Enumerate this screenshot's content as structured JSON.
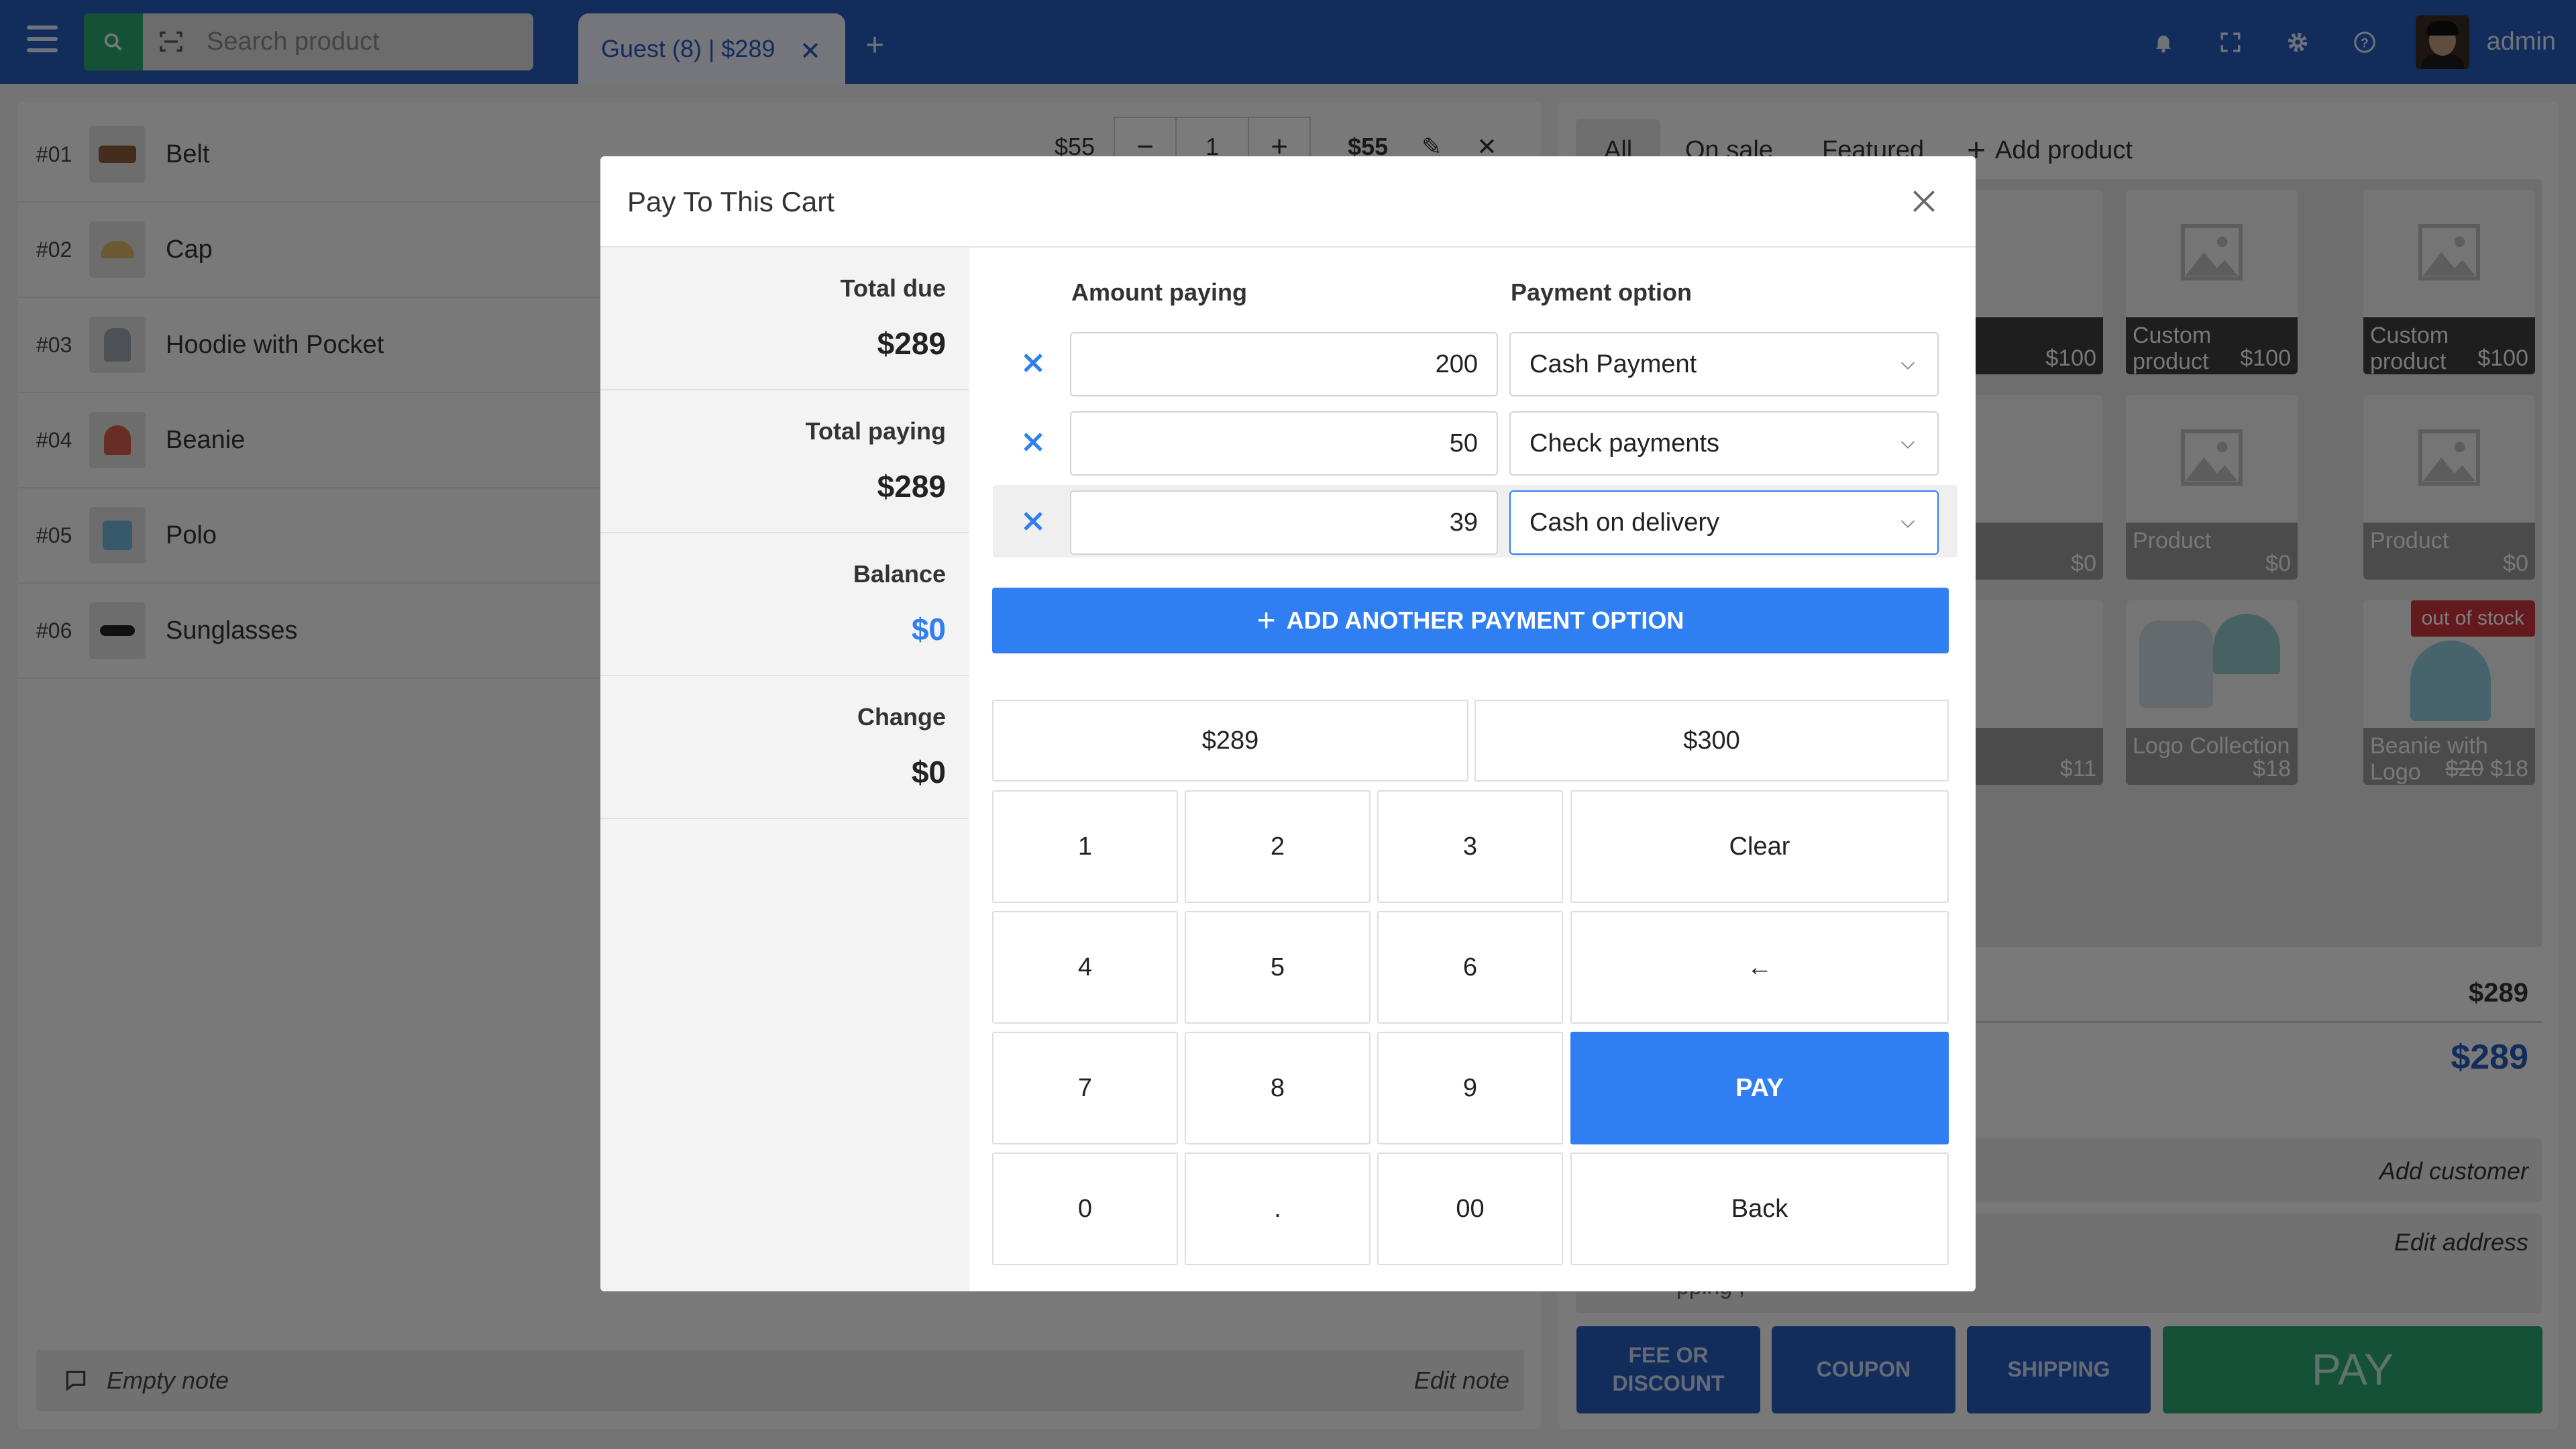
{
  "topbar": {
    "search_placeholder": "Search product",
    "tab_label": "Guest (8) | $289",
    "tab_close": "✕",
    "tab_add": "+",
    "user_name": "admin",
    "icons": [
      "bell-icon",
      "fullscreen-icon",
      "gear-icon",
      "help-icon"
    ]
  },
  "cart": {
    "items": [
      {
        "num": "#01",
        "name": "Belt"
      },
      {
        "num": "#02",
        "name": "Cap"
      },
      {
        "num": "#03",
        "name": "Hoodie with Pocket"
      },
      {
        "num": "#04",
        "name": "Beanie"
      },
      {
        "num": "#05",
        "name": "Polo"
      },
      {
        "num": "#06",
        "name": "Sunglasses"
      }
    ],
    "first_row": {
      "price": "$55",
      "qty": "1",
      "total": "$55",
      "minus": "−",
      "plus": "+",
      "remove": "✕"
    },
    "note_empty": "Empty note",
    "note_edit": "Edit note"
  },
  "products": {
    "tabs": [
      "All",
      "On sale",
      "Featured"
    ],
    "add_product": "Add product",
    "add_icon": "+",
    "tiles": [
      {
        "label": "",
        "price": "$100"
      },
      {
        "label": "Custom product",
        "price": "$100"
      },
      {
        "label": "Custom product",
        "price": "$100"
      },
      {
        "label": "",
        "price": "$0"
      },
      {
        "label": "Product",
        "price": "$0"
      },
      {
        "label": "Product",
        "price": "$0"
      },
      {
        "label": "",
        "price": "$11"
      },
      {
        "label": "Logo Collection",
        "price": "$18"
      },
      {
        "label": "Beanie with Logo",
        "old_price": "$20",
        "price": "$18"
      }
    ],
    "out_of_stock": "out of stock"
  },
  "cart_summary": {
    "subtotal": "$289",
    "total": "$289",
    "add_customer": "Add customer",
    "edit_address": "Edit address",
    "partial_text": "pping ,"
  },
  "bottom_buttons": {
    "fee": "FEE OR DISCOUNT",
    "coupon": "COUPON",
    "shipping": "SHIPPING",
    "pay": "PAY"
  },
  "modal": {
    "title": "Pay To This Cart",
    "close": "✕",
    "summary": {
      "total_due_label": "Total due",
      "total_due": "$289",
      "total_paying_label": "Total paying",
      "total_paying": "$289",
      "balance_label": "Balance",
      "balance": "$0",
      "change_label": "Change",
      "change": "$0"
    },
    "amount_header": "Amount paying",
    "option_header": "Payment option",
    "payments": [
      {
        "amount": "200",
        "option": "Cash Payment"
      },
      {
        "amount": "50",
        "option": "Check payments"
      },
      {
        "amount": "39",
        "option": "Cash on delivery"
      }
    ],
    "add_option": "ADD ANOTHER PAYMENT OPTION",
    "add_icon": "+",
    "quick": [
      "$289",
      "$300"
    ],
    "keys": [
      "1",
      "2",
      "3",
      "4",
      "5",
      "6",
      "7",
      "8",
      "9",
      "0",
      ".",
      "00"
    ],
    "clear": "Clear",
    "backspace": "←",
    "pay": "PAY",
    "back": "Back"
  },
  "colors": {
    "topbar": "#2459b7",
    "accent": "#2f7ff2",
    "green": "#28a36f",
    "danger": "#c8333a"
  }
}
